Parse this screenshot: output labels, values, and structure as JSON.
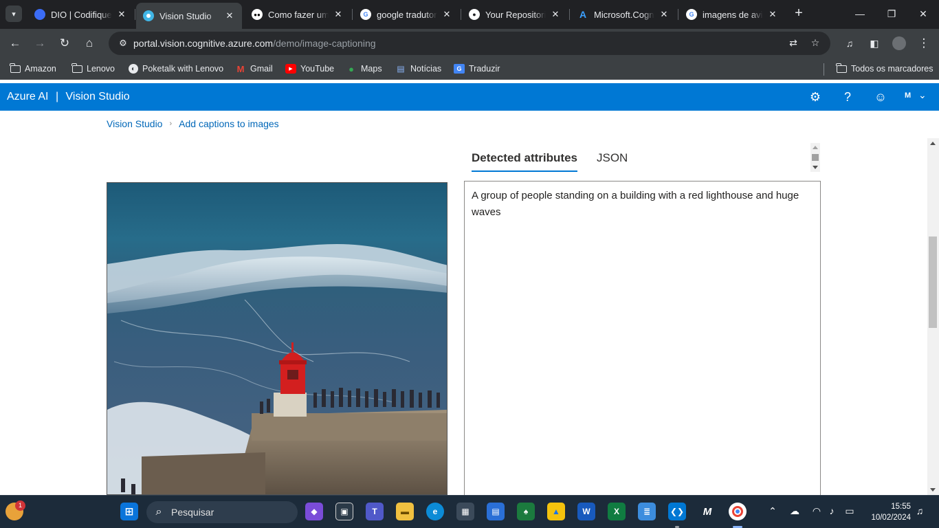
{
  "browser": {
    "tabs": [
      {
        "title": "DIO | Codifique o",
        "icon": "dio-icon",
        "color": "#3b6cf6"
      },
      {
        "title": "Vision Studio",
        "icon": "vision-studio-icon",
        "color": "#41b6e6",
        "active": true
      },
      {
        "title": "Como fazer um I",
        "icon": "medium-icon",
        "color": "#ffffff"
      },
      {
        "title": "google tradutor",
        "icon": "google-icon",
        "color": "#ffffff"
      },
      {
        "title": "Your Repositorie",
        "icon": "github-icon",
        "color": "#ffffff"
      },
      {
        "title": "Microsoft.Cognit",
        "icon": "azure-icon",
        "color": "#0078d4"
      },
      {
        "title": "imagens de avião",
        "icon": "google-icon",
        "color": "#ffffff"
      }
    ],
    "url_host": "portal.vision.cognitive.azure.com",
    "url_path": "/demo/image-captioning",
    "bookmarks": [
      {
        "label": "Amazon",
        "icon": "folder-icon"
      },
      {
        "label": "Lenovo",
        "icon": "folder-icon"
      },
      {
        "label": "Poketalk with Lenovo",
        "icon": "poketalk-icon"
      },
      {
        "label": "Gmail",
        "icon": "gmail-icon"
      },
      {
        "label": "YouTube",
        "icon": "youtube-icon"
      },
      {
        "label": "Maps",
        "icon": "maps-icon"
      },
      {
        "label": "Notícias",
        "icon": "news-icon"
      },
      {
        "label": "Traduzir",
        "icon": "translate-icon"
      }
    ],
    "all_bookmarks_label": "Todos os marcadores"
  },
  "azure": {
    "brand": "Azure AI",
    "divider": "|",
    "product": "Vision Studio",
    "user_initial": "M",
    "accent_color": "#0078d4"
  },
  "page": {
    "breadcrumb": [
      "Vision Studio",
      "Add captions to images"
    ],
    "tabs": [
      "Detected attributes",
      "JSON"
    ],
    "caption": "A group of people standing on a building with a red lighthouse and huge waves"
  },
  "taskbar": {
    "search_placeholder": "Pesquisar",
    "time": "15:55",
    "date": "10/02/2024",
    "widget_badge": "1"
  }
}
